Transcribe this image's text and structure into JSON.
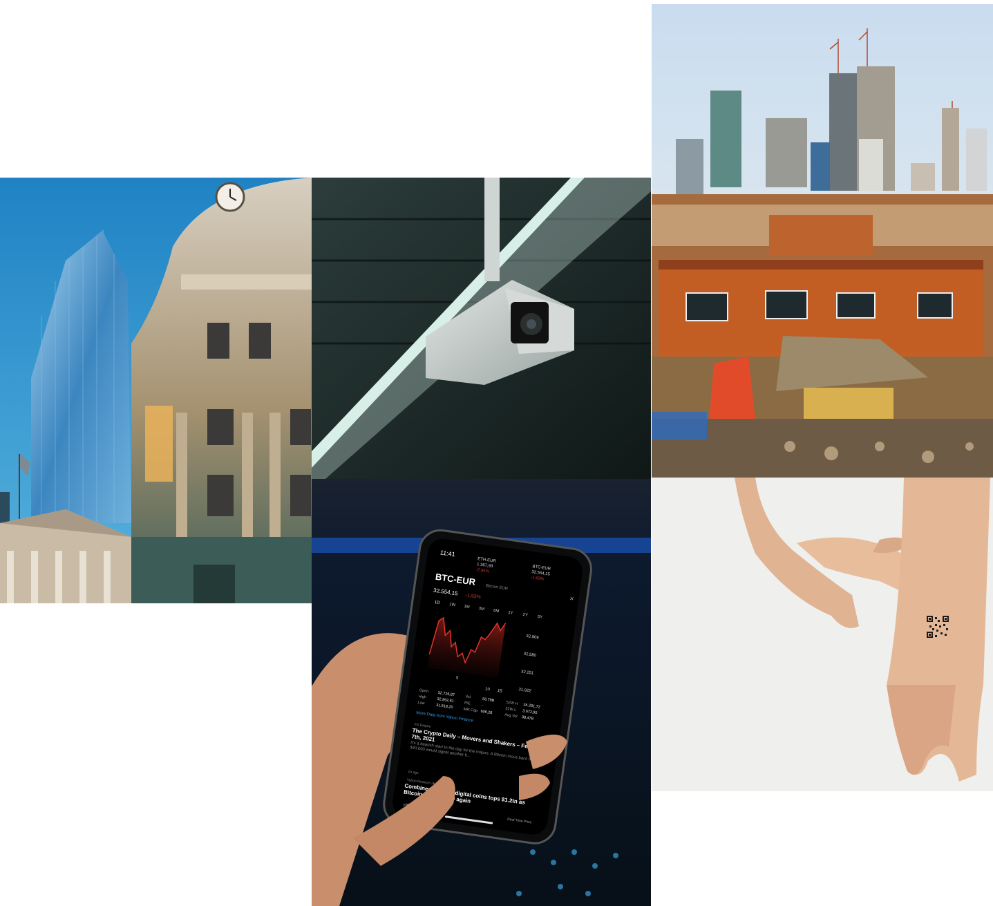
{
  "gallery": {
    "photos": [
      {
        "subject": "classical domed building with clock beside a glass skyscraper"
      },
      {
        "subject": "ceiling mounted security camera"
      },
      {
        "subject": "hand holding a smartphone showing a crypto chart"
      },
      {
        "subject": "high-rise towers behind a dense slum"
      },
      {
        "subject": "wrist with a QR code tattoo being pointed at"
      }
    ]
  },
  "phone_screen": {
    "time": "11:41",
    "ticker_left": {
      "symbol": "ETH-EUR",
      "price": "1.367,93",
      "change": "-2,94%"
    },
    "ticker_right": {
      "symbol": "BTC-EUR",
      "price": "32.554,15",
      "change": "-1,93%"
    },
    "symbol": "BTC-EUR",
    "name": "Bitcoin EUR",
    "price": "32.554,15",
    "change": "-1,93%",
    "ranges": [
      "1D",
      "1W",
      "1M",
      "3M",
      "6M",
      "1Y",
      "2Y",
      "5Y"
    ],
    "y_ticks": [
      "32.909",
      "32.580",
      "32.251",
      "31.922"
    ],
    "x_ticks": [
      "5",
      "10",
      "15"
    ],
    "stats": {
      "open_label": "Open",
      "open": "32.726,87",
      "high_label": "High",
      "high": "32.992,81",
      "low_label": "Low",
      "low": "31.618,20",
      "vol_label": "Vol",
      "vol": "56,78B",
      "pe_label": "P/E",
      "pe": "-",
      "mktcap_label": "Mkt Cap",
      "mktcap": "606,28",
      "w52h_label": "52W H",
      "w52h": "34.261,72",
      "w52l_label": "52W L",
      "w52l": "3.672,95",
      "avgvol_label": "Avg Vol",
      "avgvol": "38,47B"
    },
    "more_link": "More Data from Yahoo Finance",
    "news1_source": "FX Empire",
    "news1_title": "The Crypto Daily – Movers and Shakers – February 7th, 2021",
    "news1_snippet": "It's a bearish start to the day for the majors. A Bitcoin move back through to $40,000 would signal another b...",
    "news1_age": "1h ago",
    "news2_source": "Yahoo Finance UK",
    "news2_title": "Combined value of digital coins tops $1.2tn as Bitcoin hits $40,000 again",
    "footer_brand": "yahoo!finance",
    "footer_right": "Real Time Price"
  },
  "colors": {
    "sky_blue": "#2a8fc9",
    "stone": "#b9a88f",
    "cam_dark": "#15201f",
    "chart_red": "#e0352b",
    "rust": "#b8501f",
    "skin": "#e2b594",
    "paper": "#eeeeec"
  }
}
